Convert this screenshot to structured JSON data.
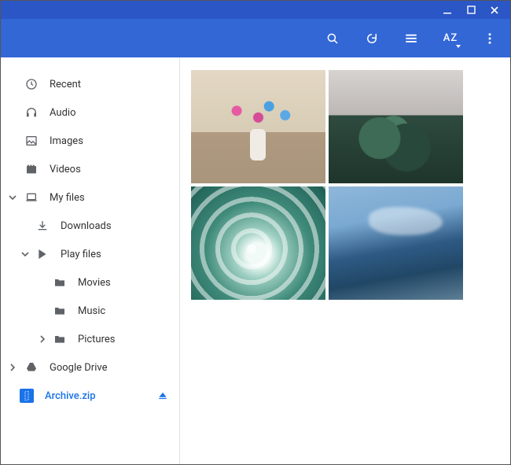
{
  "sidebar": {
    "items": [
      {
        "label": "Recent"
      },
      {
        "label": "Audio"
      },
      {
        "label": "Images"
      },
      {
        "label": "Videos"
      },
      {
        "label": "My files"
      },
      {
        "label": "Downloads"
      },
      {
        "label": "Play files"
      },
      {
        "label": "Movies"
      },
      {
        "label": "Music"
      },
      {
        "label": "Pictures"
      },
      {
        "label": "Google Drive"
      }
    ],
    "archive": {
      "label": "Archive.zip"
    }
  },
  "toolbar": {
    "sort_label": "AZ"
  }
}
